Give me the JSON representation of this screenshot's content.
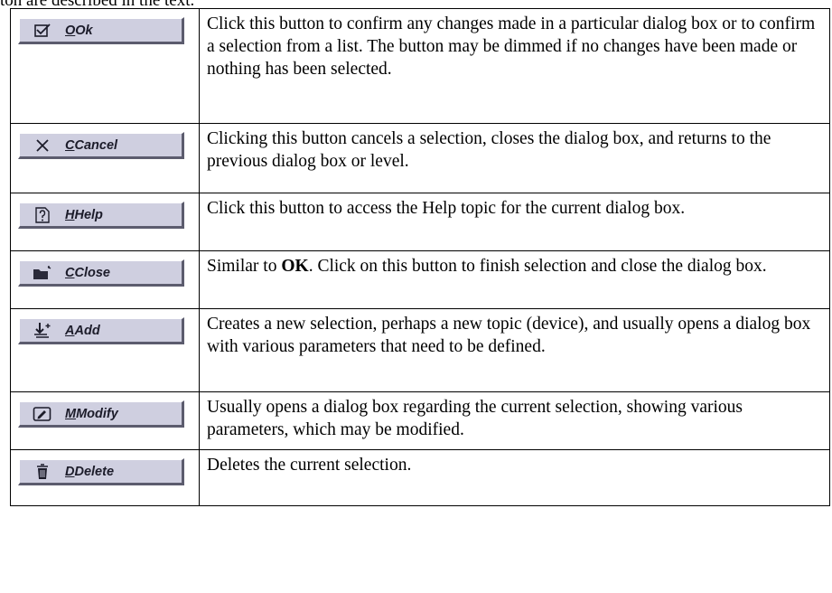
{
  "intro_text": "ton are described in the text.",
  "rows": [
    {
      "button": {
        "icon": "checkbox-icon",
        "mnemonic": "O",
        "label": "Ok"
      },
      "description": "Click this button to confirm any changes made in a particular dialog box or to confirm a selection from a list. The button may be dimmed if no changes have been made or nothing has been selected."
    },
    {
      "button": {
        "icon": "x-icon",
        "mnemonic": "C",
        "label": "Cancel"
      },
      "description": "Clicking this button cancels a selection, closes the dialog box, and returns to the previous dialog box or level."
    },
    {
      "button": {
        "icon": "help-question-icon",
        "mnemonic": "H",
        "label": "Help"
      },
      "description": "Click this button to access the Help topic for the current dialog box."
    },
    {
      "button": {
        "icon": "folder-close-icon",
        "mnemonic": "C",
        "label": "Close"
      },
      "description_parts": {
        "pre": "Similar to ",
        "bold": "OK",
        "post": ". Click on this button to finish selection and close the dialog box."
      }
    },
    {
      "button": {
        "icon": "add-down-arrow-icon",
        "mnemonic": "A",
        "label": "Add"
      },
      "description": "Creates a new selection, perhaps a new topic (device), and usually opens a dialog box with various parameters that need to be defined."
    },
    {
      "button": {
        "icon": "edit-pencil-icon",
        "mnemonic": "M",
        "label": "Modify"
      },
      "description": "Usually opens a dialog box regarding the current selection, showing various parameters, which may be modified."
    },
    {
      "button": {
        "icon": "trash-icon",
        "mnemonic": "D",
        "label": "Delete"
      },
      "description": "Deletes the current selection."
    }
  ]
}
